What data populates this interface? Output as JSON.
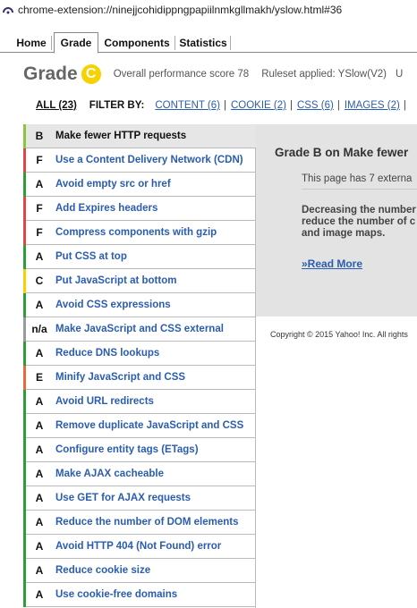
{
  "browser": {
    "url": "chrome-extension://ninejjcohidippngpapiilnmkgllmakh/yslow.html#36"
  },
  "tabs": [
    {
      "label": "Home"
    },
    {
      "label": "Grade"
    },
    {
      "label": "Components"
    },
    {
      "label": "Statistics"
    }
  ],
  "header": {
    "title": "Grade",
    "grade": "C",
    "perf_label": "Overall performance score 78",
    "ruleset_label": "Ruleset applied: YSlow(V2)",
    "extra": "U"
  },
  "filters": {
    "all": "ALL (23)",
    "by_label": "FILTER BY:",
    "items": [
      {
        "label": "CONTENT (6)"
      },
      {
        "label": "COOKIE (2)"
      },
      {
        "label": "CSS (6)"
      },
      {
        "label": "IMAGES (2)"
      }
    ]
  },
  "rules": [
    {
      "grade": "B",
      "label": "Make fewer HTTP requests",
      "color": "#8cc63f"
    },
    {
      "grade": "F",
      "label": "Use a Content Delivery Network (CDN)",
      "color": "#e0474c"
    },
    {
      "grade": "A",
      "label": "Avoid empty src or href",
      "color": "#2e9e3c"
    },
    {
      "grade": "F",
      "label": "Add Expires headers",
      "color": "#e0474c"
    },
    {
      "grade": "F",
      "label": "Compress components with gzip",
      "color": "#e0474c"
    },
    {
      "grade": "A",
      "label": "Put CSS at top",
      "color": "#2e9e3c"
    },
    {
      "grade": "C",
      "label": "Put JavaScript at bottom",
      "color": "#f5d200"
    },
    {
      "grade": "A",
      "label": "Avoid CSS expressions",
      "color": "#2e9e3c"
    },
    {
      "grade": "n/a",
      "label": "Make JavaScript and CSS external",
      "color": "#9a9a9a"
    },
    {
      "grade": "A",
      "label": "Reduce DNS lookups",
      "color": "#2e9e3c"
    },
    {
      "grade": "E",
      "label": "Minify JavaScript and CSS",
      "color": "#e86a3a"
    },
    {
      "grade": "A",
      "label": "Avoid URL redirects",
      "color": "#2e9e3c"
    },
    {
      "grade": "A",
      "label": "Remove duplicate JavaScript and CSS",
      "color": "#2e9e3c"
    },
    {
      "grade": "A",
      "label": "Configure entity tags (ETags)",
      "color": "#2e9e3c"
    },
    {
      "grade": "A",
      "label": "Make AJAX cacheable",
      "color": "#2e9e3c"
    },
    {
      "grade": "A",
      "label": "Use GET for AJAX requests",
      "color": "#2e9e3c"
    },
    {
      "grade": "A",
      "label": "Reduce the number of DOM elements",
      "color": "#2e9e3c"
    },
    {
      "grade": "A",
      "label": "Avoid HTTP 404 (Not Found) error",
      "color": "#2e9e3c"
    },
    {
      "grade": "A",
      "label": "Reduce cookie size",
      "color": "#2e9e3c"
    },
    {
      "grade": "A",
      "label": "Use cookie-free domains",
      "color": "#2e9e3c"
    }
  ],
  "detail": {
    "title": "Grade B on Make fewer",
    "line1": "This page has 7 externa",
    "desc": [
      "Decreasing the number",
      "reduce the number of c",
      "and image maps."
    ],
    "read_more": "»Read More"
  },
  "footer": {
    "copyright": "Copyright © 2015 Yahoo! Inc. All rights"
  }
}
